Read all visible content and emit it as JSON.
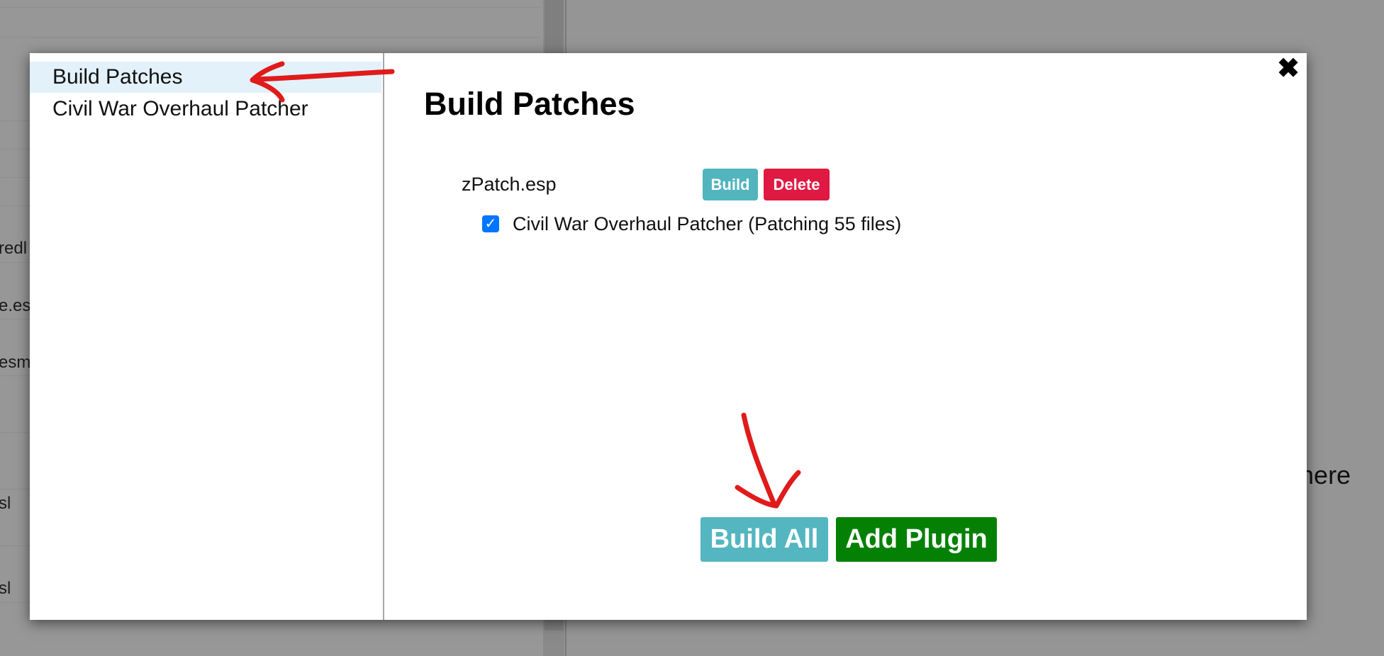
{
  "background": {
    "list_fragments": [
      "redl",
      "e.esl",
      "esm",
      "sl",
      "sl"
    ],
    "right_text": "e here"
  },
  "modal": {
    "sidebar": {
      "items": [
        {
          "label": "Build Patches",
          "selected": true
        },
        {
          "label": "Civil War Overhaul Patcher",
          "selected": false
        }
      ]
    },
    "close_glyph": "✖",
    "title": "Build Patches",
    "patch": {
      "filename": "zPatch.esp",
      "build_label": "Build",
      "delete_label": "Delete",
      "patcher": {
        "checked": true,
        "label": "Civil War Overhaul Patcher",
        "detail": "(Patching 55 files)"
      }
    },
    "footer": {
      "build_all_label": "Build All",
      "add_plugin_label": "Add Plugin"
    }
  },
  "colors": {
    "selected_bg": "#e3f1fb",
    "build": "#52b5be",
    "delete": "#df1942",
    "add_plugin": "#048104",
    "checkbox": "#0075ff",
    "annotation": "#e01b1b"
  },
  "icons": {
    "close": "close-icon",
    "checkbox": "checkmark-icon"
  }
}
